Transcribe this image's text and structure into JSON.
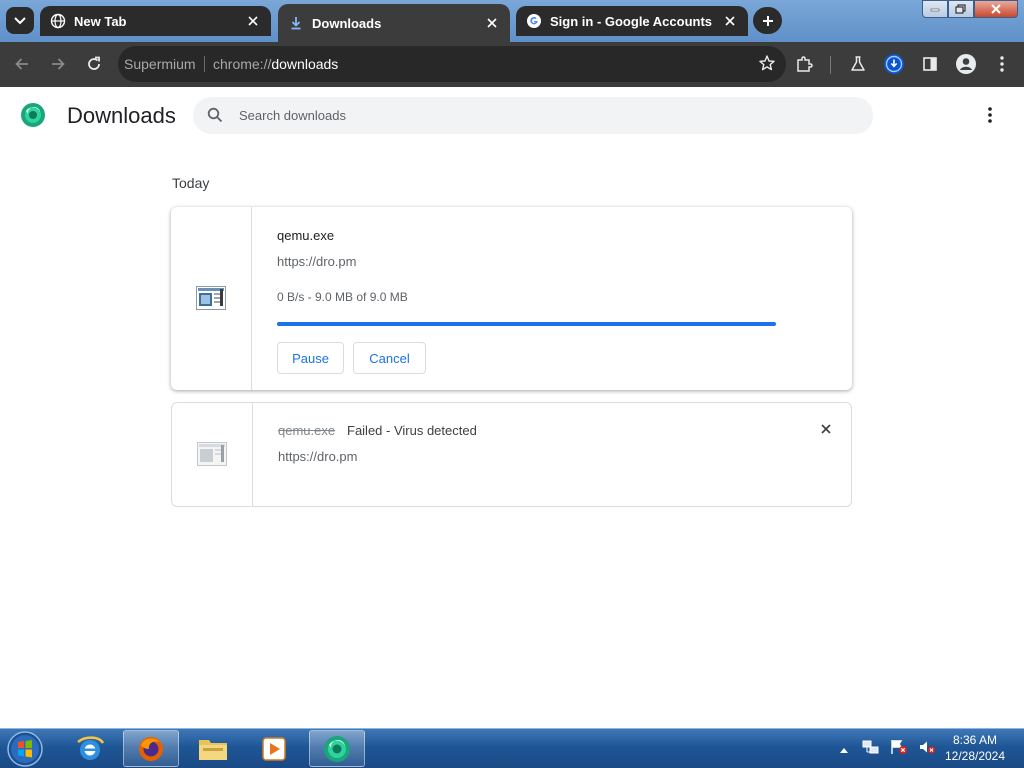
{
  "tabs": [
    {
      "title": "New Tab",
      "favicon": "globe-icon",
      "active": false
    },
    {
      "title": "Downloads",
      "favicon": "download-icon",
      "active": true
    },
    {
      "title": "Sign in - Google Accounts",
      "favicon": "google-g-icon",
      "active": false
    }
  ],
  "toolbar": {
    "origin_chip": "Supermium",
    "url_prefix": "chrome://",
    "url_path": "downloads",
    "icons": [
      "back-icon",
      "forward-icon",
      "reload-icon",
      "bookmark-star-icon",
      "extensions-icon",
      "labs-flask-icon",
      "downloads-indicator-icon",
      "side-panel-icon",
      "profile-icon",
      "menu-icon"
    ]
  },
  "page": {
    "title": "Downloads",
    "search_placeholder": "Search downloads",
    "section_label": "Today"
  },
  "downloads": [
    {
      "file_name": "qemu.exe",
      "url": "https://dro.pm",
      "progress_text": "0 B/s - 9.0 MB of 9.0 MB",
      "progress": 1.0,
      "pause_label": "Pause",
      "cancel_label": "Cancel"
    },
    {
      "file_name": "qemu.exe",
      "status": "Failed - Virus detected",
      "url": "https://dro.pm"
    }
  ],
  "taskbar": {
    "apps": [
      "internet-explorer-icon",
      "firefox-icon",
      "file-explorer-icon",
      "media-player-icon",
      "supermium-icon"
    ],
    "tray_icons": [
      "show-hidden-icons-arrow",
      "network-icon",
      "action-center-flag-icon",
      "volume-muted-icon"
    ],
    "time": "8:36 AM",
    "date": "12/28/2024"
  },
  "colors": {
    "accent": "#1a73e8",
    "tab_dark": "#2b2b2b",
    "toolbar": "#3c3c3c",
    "taskbar": "#1f5696"
  }
}
